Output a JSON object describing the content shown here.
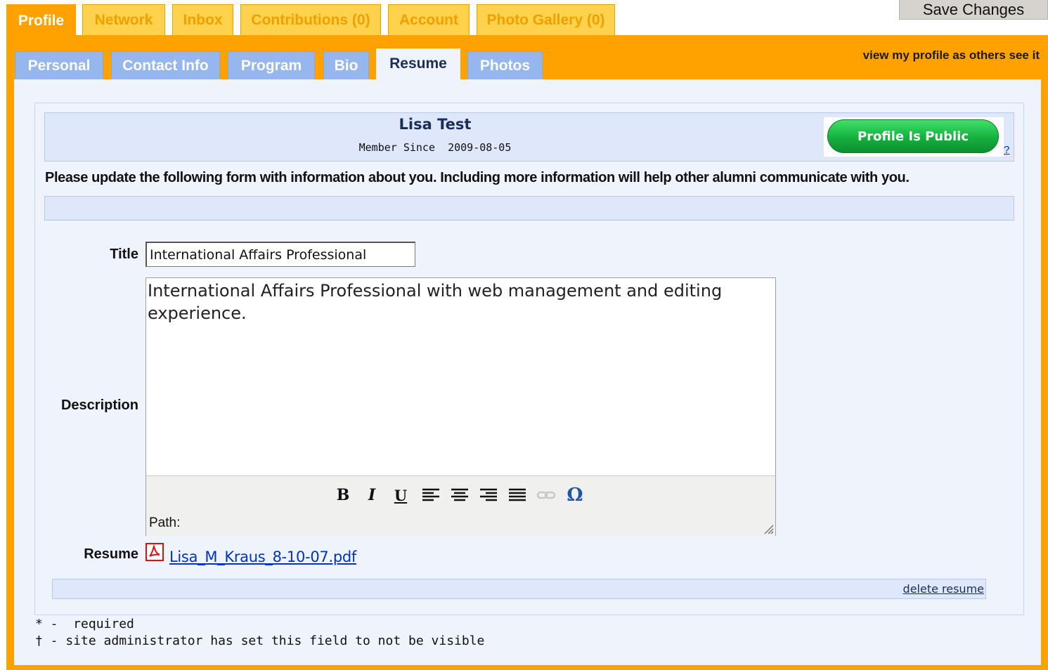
{
  "top_tabs": [
    {
      "label": "Profile"
    },
    {
      "label": "Network"
    },
    {
      "label": "Inbox"
    },
    {
      "label": "Contributions (0)"
    },
    {
      "label": "Account"
    },
    {
      "label": "Photo Gallery (0)"
    }
  ],
  "save_label": "Save Changes",
  "sub_tabs": [
    {
      "label": "Personal"
    },
    {
      "label": "Contact Info"
    },
    {
      "label": "Program"
    },
    {
      "label": "Bio"
    },
    {
      "label": "Resume"
    },
    {
      "label": "Photos"
    }
  ],
  "view_profile_link": "view my profile as others see it",
  "profile": {
    "name": "Lisa Test",
    "member_since_label": "Member Since",
    "member_since_date": "2009-08-05",
    "public_button": "Profile Is Public",
    "help": "?"
  },
  "instruction": "Please update the following form with information about you. Including more information will help other alumni communicate with you.",
  "form": {
    "title_label": "Title",
    "title_value": "International Affairs Professional",
    "description_label": "Description",
    "description_value": "International Affairs Professional with web management and editing experience.",
    "path_label": "Path:",
    "resume_label": "Resume",
    "resume_file": "Lisa_M_Kraus_8-10-07.pdf",
    "delete_label": "delete resume"
  },
  "toolbar": {
    "bold": "B",
    "italic": "I",
    "underline": "U",
    "omega": "Ω"
  },
  "footnotes": {
    "required": "* -  required",
    "hidden": "† - site administrator has set this field to not be visible"
  },
  "colors": {
    "accent_orange": "#ffa200",
    "tab_yellow": "#ffd24d",
    "subtab_blue": "#96b6ee",
    "public_green": "#15b03e"
  }
}
